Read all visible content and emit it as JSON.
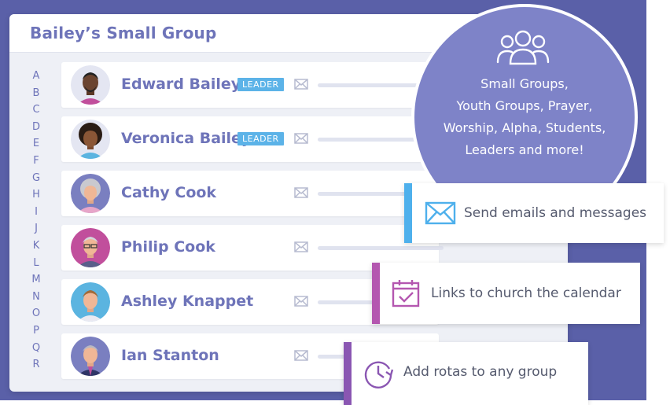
{
  "group": {
    "title": "Bailey’s Small Group"
  },
  "alphabet": [
    "A",
    "B",
    "C",
    "D",
    "E",
    "F",
    "G",
    "H",
    "I",
    "J",
    "K",
    "L",
    "M",
    "N",
    "O",
    "P",
    "Q",
    "R"
  ],
  "members": [
    {
      "name": "Edward Bailey",
      "badge": "LEADER"
    },
    {
      "name": "Veronica Bailey",
      "badge": "LEADER"
    },
    {
      "name": "Cathy Cook",
      "badge": ""
    },
    {
      "name": "Philip Cook",
      "badge": ""
    },
    {
      "name": "Ashley Knappet",
      "badge": ""
    },
    {
      "name": "Ian Stanton",
      "badge": ""
    }
  ],
  "bubble": {
    "icon": "people-group-icon",
    "lines": [
      "Small Groups,",
      "Youth Groups, Prayer,",
      "Worship, Alpha, Students,",
      "Leaders and more!"
    ]
  },
  "features": [
    {
      "text": "Send emails and messages",
      "icon": "envelope-icon",
      "accent": "#4eb0ec"
    },
    {
      "text": "Links to church the calendar",
      "icon": "calendar-check-icon",
      "accent": "#b457b0"
    },
    {
      "text": "Add rotas to any group",
      "icon": "clock-refresh-icon",
      "accent": "#8a56b2"
    }
  ],
  "colors": {
    "brand": "#6e74b9",
    "background": "#5a60a8",
    "leader_badge": "#5cb3e8"
  }
}
